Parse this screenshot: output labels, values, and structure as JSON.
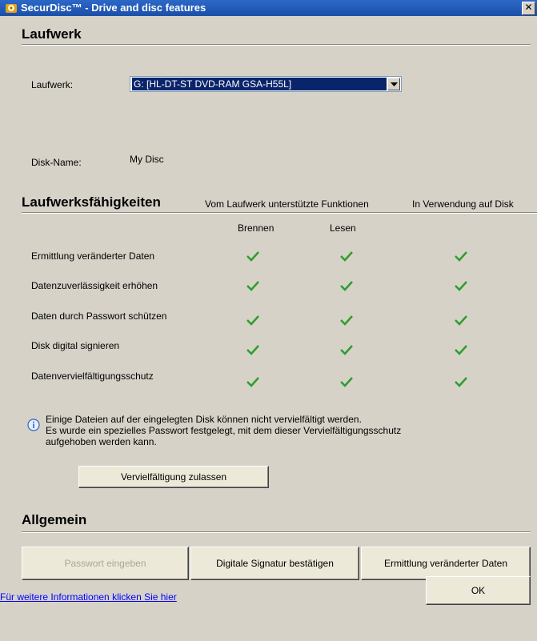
{
  "window": {
    "title": "SecurDisc™ - Drive and disc features",
    "close_glyph": "✕"
  },
  "drive_section": {
    "title": "Laufwerk",
    "drive_label": "Laufwerk:",
    "drive_value": "G: [HL-DT-ST DVD-RAM GSA-H55L]",
    "disk_name_label": "Disk-Name:",
    "disk_name_value": "My Disc"
  },
  "capabilities": {
    "title": "Laufwerksfähigkeiten",
    "header_supported": "Vom Laufwerk unterstützte Funktionen",
    "header_in_use": "In Verwendung auf Disk",
    "col_burn": "Brennen",
    "col_read": "Lesen",
    "rows": [
      {
        "label": "Ermittlung veränderter Daten",
        "burn": true,
        "read": true,
        "in_use": true
      },
      {
        "label": "Datenzuverlässigkeit erhöhen",
        "burn": true,
        "read": true,
        "in_use": true
      },
      {
        "label": "Daten durch Passwort schützen",
        "burn": true,
        "read": true,
        "in_use": true
      },
      {
        "label": "Disk digital signieren",
        "burn": true,
        "read": true,
        "in_use": true
      },
      {
        "label": "Datenvervielfältigungsschutz",
        "burn": true,
        "read": true,
        "in_use": true
      }
    ],
    "check_color": "#2e9e2e"
  },
  "info": {
    "icon": "info-icon",
    "line1": "Einige Dateien auf der eingelegten Disk können nicht vervielfältigt werden.",
    "line2": "Es wurde ein spezielles Passwort festgelegt, mit dem dieser Vervielfältigungsschutz",
    "line3": "aufgehoben werden kann.",
    "allow_button": "Vervielfältigung zulassen"
  },
  "general": {
    "title": "Allgemein",
    "btn_password": "Passwort eingeben",
    "btn_signature": "Digitale Signatur bestätigen",
    "btn_changed": "Ermittlung veränderter Daten"
  },
  "footer": {
    "more_info_link": "Für weitere Informationen klicken Sie hier",
    "ok_button": "OK"
  }
}
